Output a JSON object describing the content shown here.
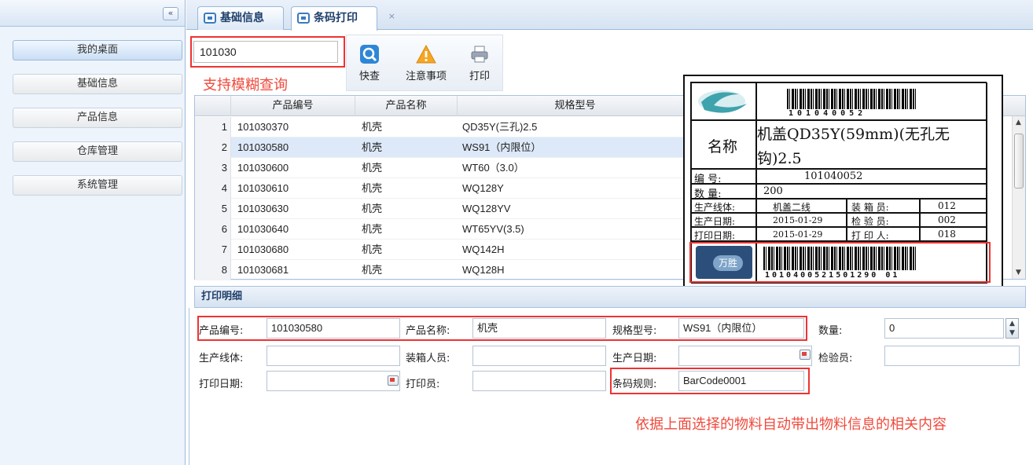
{
  "sidebar": {
    "collapse_label": "«",
    "items": [
      {
        "label": "我的桌面"
      },
      {
        "label": "基础信息"
      },
      {
        "label": "产品信息"
      },
      {
        "label": "仓库管理"
      },
      {
        "label": "系统管理"
      }
    ]
  },
  "tabs": [
    {
      "label": "基础信息"
    },
    {
      "label": "条码打印",
      "close": "×"
    }
  ],
  "toolbar": {
    "search_value": "101030",
    "fuzzy_hint": "支持模糊查询",
    "buttons": [
      {
        "label": "快查",
        "icon": "search-icon"
      },
      {
        "label": "注意事项",
        "icon": "warning-icon"
      },
      {
        "label": "打印",
        "icon": "printer-icon"
      }
    ]
  },
  "grid": {
    "columns": [
      "产品编号",
      "产品名称",
      "规格型号"
    ],
    "rows": [
      {
        "no": "1",
        "code": "101030370",
        "name": "机壳",
        "spec": "QD35Y(三孔)2.5"
      },
      {
        "no": "2",
        "code": "101030580",
        "name": "机壳",
        "spec": "WS91（内限位）"
      },
      {
        "no": "3",
        "code": "101030600",
        "name": "机壳",
        "spec": "WT60（3.0）"
      },
      {
        "no": "4",
        "code": "101030610",
        "name": "机壳",
        "spec": "WQ128Y"
      },
      {
        "no": "5",
        "code": "101030630",
        "name": "机壳",
        "spec": "WQ128YV"
      },
      {
        "no": "6",
        "code": "101030640",
        "name": "机壳",
        "spec": "WT65YV(3.5)"
      },
      {
        "no": "7",
        "code": "101030680",
        "name": "机壳",
        "spec": "WQ142H"
      },
      {
        "no": "8",
        "code": "101030681",
        "name": "机壳",
        "spec": "WQ128H"
      }
    ],
    "selected_row": 2
  },
  "label_preview": {
    "top_barcode_number": "101040052",
    "name_label": "名称",
    "name_line1": "机盖QD35Y(59mm)(无孔无",
    "name_line2": "钩)2.5",
    "code_label": "编    号:",
    "code_value": "101040052",
    "qty_label": "数    量:",
    "qty_value": "200",
    "line_label": "生产线体:",
    "line_value": "机盖二线",
    "packer_label": "装 箱 员:",
    "packer_value": "012",
    "prod_date_label": "生产日期:",
    "prod_date_value": "2015-01-29",
    "inspector_label": "检 验 员:",
    "inspector_value": "002",
    "print_date_label": "打印日期:",
    "print_date_value": "2015-01-29",
    "printer_label": "打 印 人:",
    "printer_value": "018",
    "logo_text": "万胜",
    "bottom_barcode_number": "1010400521501290 01"
  },
  "detail": {
    "section_title": "打印明细",
    "fields": {
      "code_label": "产品编号:",
      "code_value": "101030580",
      "name_label": "产品名称:",
      "name_value": "机壳",
      "spec_label": "规格型号:",
      "spec_value": "WS91（内限位）",
      "qty_label": "数量:",
      "qty_value": "0",
      "line_label": "生产线体:",
      "packer_label": "装箱人员:",
      "prod_date_label": "生产日期:",
      "inspector_label": "检验员:",
      "print_date_label": "打印日期:",
      "printer_label": "打印员:",
      "rule_label": "条码规则:",
      "rule_value": "BarCode0001"
    },
    "auto_hint": "依据上面选择的物料自动带出物料信息的相关内容"
  },
  "colors": {
    "accent_blue": "#3a7bc0",
    "highlight_red": "#ee3333",
    "hint_red": "#ef4a3c",
    "selected_row": "#dde9f8"
  }
}
